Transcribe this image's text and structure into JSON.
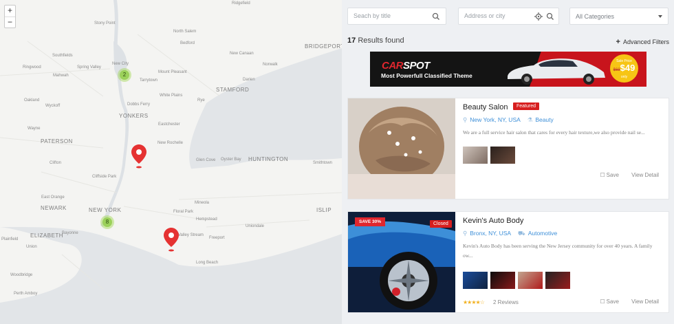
{
  "map": {
    "zoom_in": "+",
    "zoom_out": "−",
    "clusters": [
      {
        "count": "2"
      },
      {
        "count": "8"
      }
    ],
    "labels": {
      "ridgefield": "Ridgefield",
      "stony_point": "Stony Point",
      "north_salem": "North Salem",
      "bedford": "Bedford",
      "bridgeport": "BRIDGEPORT",
      "new_canaan": "New Canaan",
      "norwalk": "Norwalk",
      "ringwood": "Ringwood",
      "southfields": "Southfields",
      "spring_valley": "Spring Valley",
      "mahwah": "Mahwah",
      "new_city": "New City",
      "mount_pleasant": "Mount Pleasant",
      "tarrytown": "Tarrytown",
      "darien": "Darien",
      "stamford": "STAMFORD",
      "oakland": "Oakland",
      "wyckoff": "Wyckoff",
      "dobbs_ferry": "Dobbs Ferry",
      "white_plains": "White Plains",
      "rye": "Rye",
      "wayne": "Wayne",
      "yonkers": "YONKERS",
      "eastchester": "Eastchester",
      "paterson": "PATERSON",
      "new_rochelle": "New Rochelle",
      "glen_cove": "Glen Cove",
      "oyster_bay": "Oyster Bay",
      "huntington": "HUNTINGTON",
      "smithtown": "Smithtown",
      "clifton": "Clifton",
      "cliffside_park": "Cliffside Park",
      "east_orange": "East Orange",
      "newark": "NEWARK",
      "new_york": "NEW YORK",
      "floral_park": "Floral Park",
      "mineola": "Mineola",
      "hempstead": "Hempstead",
      "islip": "ISLIP",
      "uniondale": "Uniondale",
      "elizabeth": "ELIZABETH",
      "bayonne": "Bayonne",
      "valley_stream": "Valley Stream",
      "freeport": "Freeport",
      "long_beach": "Long Beach",
      "plainfield": "Plainfield",
      "union": "Union",
      "woodbridge": "Woodbridge",
      "perth_amboy": "Perth Amboy"
    }
  },
  "search": {
    "title_placeholder": "Seach by title",
    "address_placeholder": "Address or city",
    "category": "All Categories"
  },
  "results": {
    "count": "17",
    "label": "Results found",
    "advanced": "Advanced Filters"
  },
  "banner": {
    "brand_a": "CAR",
    "brand_b": "SPOT",
    "tagline": "Most Powerfull Classified Theme",
    "badge_top": "Sale Price",
    "badge_old": "$69",
    "badge_price": "$49",
    "badge_bottom": "only"
  },
  "listings": [
    {
      "title": "Beauty Salon",
      "badge": "Featured",
      "location": "New York, NY, USA",
      "category": "Beauty",
      "description": "We are a full service hair salon that cares for every hair texture,we also provide nail se...",
      "save": "Save",
      "view": "View Detail"
    },
    {
      "title": "Kevin's Auto Body",
      "badge": "Closed",
      "ribbon": "SAVE 30%",
      "location": "Bronx, NY, USA",
      "category": "Automotive",
      "description": "Kevin's Auto Body has been serving the New Jersey community for over 40 years. A family ow...",
      "rating": 3.5,
      "stars": "★★★★☆",
      "reviews": "2 Reviews",
      "save": "Save",
      "view": "View Detail"
    }
  ],
  "colors": {
    "accent_red": "#d71f1f",
    "link_blue": "#3d8fd8",
    "cluster_green": "#9bd15a",
    "star_gold": "#f2b01e"
  }
}
